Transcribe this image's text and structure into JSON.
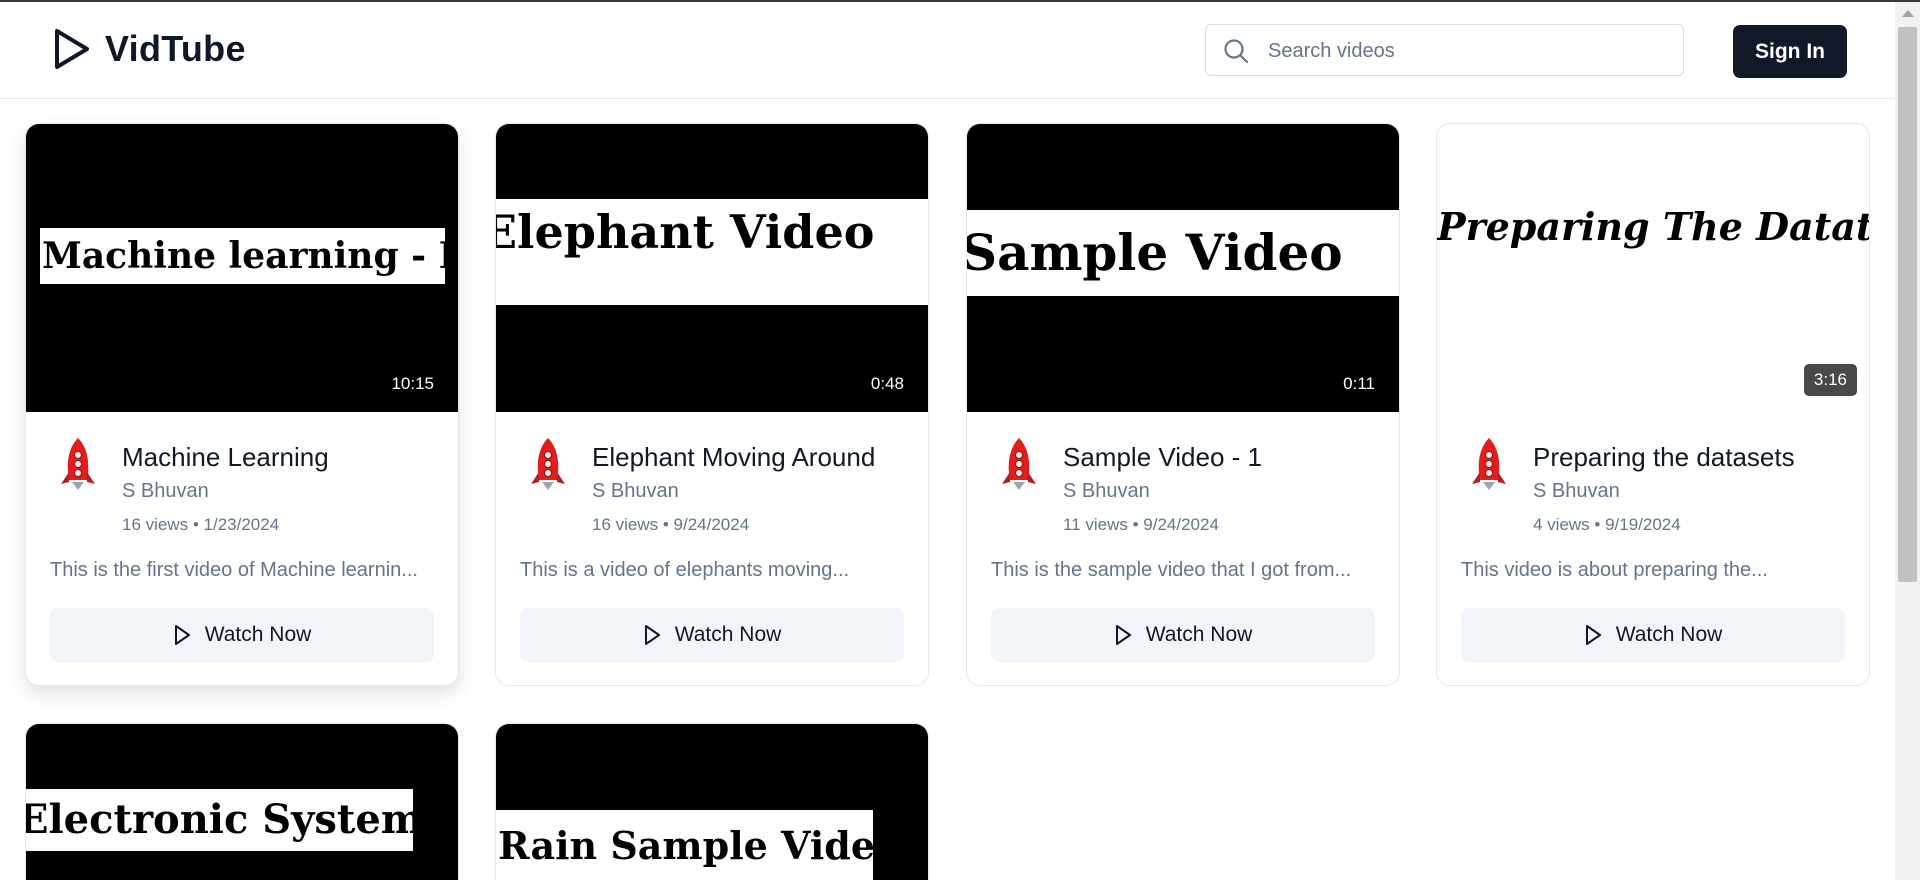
{
  "app": {
    "name": "VidTube"
  },
  "header": {
    "logo_icon": "play-icon",
    "search": {
      "placeholder": "Search videos",
      "value": ""
    },
    "signin_label": "Sign In"
  },
  "videos": [
    {
      "thumbnail_text": "Machine learning - I",
      "duration": "10:15",
      "title": "Machine Learning",
      "channel": "S Bhuvan",
      "meta": "16 views • 1/23/2024",
      "description": "This is the first video of Machine learnin...",
      "button_label": "Watch Now"
    },
    {
      "thumbnail_text": "Elephant Video",
      "duration": "0:48",
      "title": "Elephant Moving Around",
      "channel": "S Bhuvan",
      "meta": "16 views • 9/24/2024",
      "description": "This is a video of elephants moving...",
      "button_label": "Watch Now"
    },
    {
      "thumbnail_text": "Sample Video",
      "duration": "0:11",
      "title": "Sample Video - 1",
      "channel": "S Bhuvan",
      "meta": "11 views • 9/24/2024",
      "description": "This is the sample video that I got from...",
      "button_label": "Watch Now"
    },
    {
      "thumbnail_text": "Preparing The Datatsets",
      "duration": "3:16",
      "title": "Preparing the datasets",
      "channel": "S Bhuvan",
      "meta": "4 views • 9/19/2024",
      "description": "This video is about preparing the...",
      "button_label": "Watch Now"
    },
    {
      "thumbnail_text": "Electronic System"
    },
    {
      "thumbnail_text": "Rain Sample Video"
    }
  ],
  "colors": {
    "primary": "#111827",
    "muted": "#64748b",
    "button_bg": "#f1f5f9"
  }
}
